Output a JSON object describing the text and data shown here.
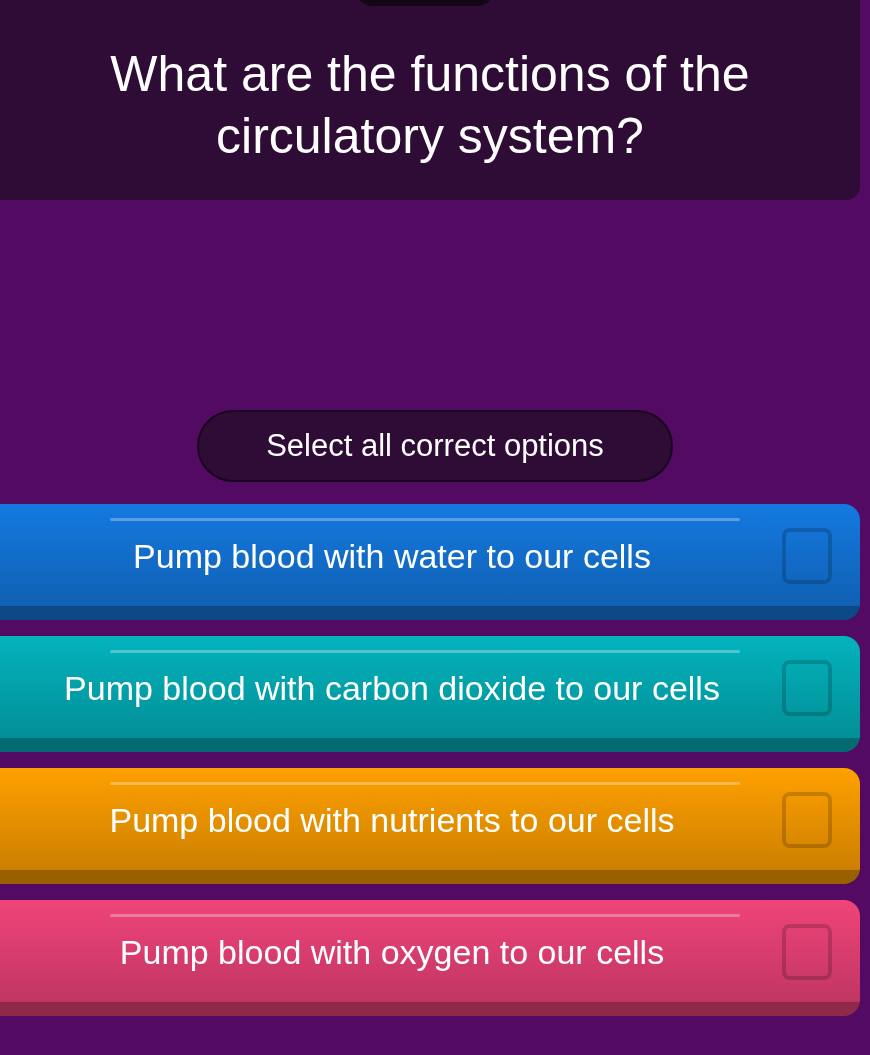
{
  "question": "What are the functions of the circulatory system?",
  "instruction": "Select all correct options",
  "options": [
    {
      "label": "Pump blood with water to our cells",
      "color": "#1479e0",
      "checked": false
    },
    {
      "label": "Pump blood with carbon dioxide to our cells",
      "color": "#03b3bd",
      "checked": false
    },
    {
      "label": "Pump blood with nutrients to our cells",
      "color": "#ffa000",
      "checked": false
    },
    {
      "label": "Pump blood with oxygen to our cells",
      "color": "#f0447a",
      "checked": false
    }
  ]
}
